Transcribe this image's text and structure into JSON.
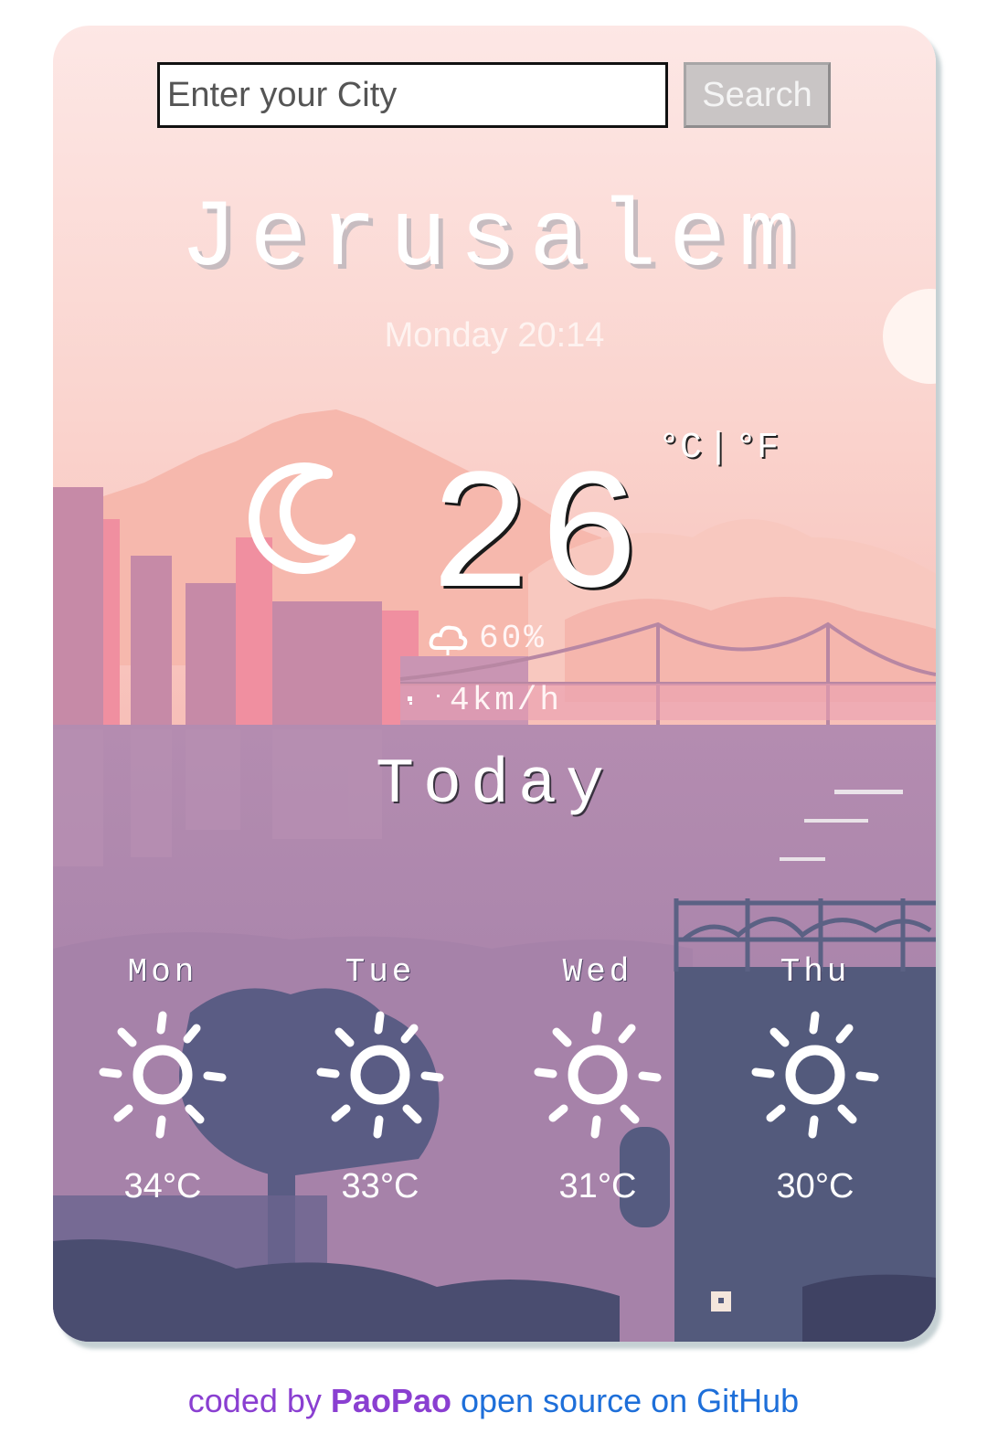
{
  "search": {
    "placeholder": "Enter your City",
    "value": "",
    "button_label": "Search"
  },
  "current": {
    "city": "Jerusalem",
    "datetime": "Monday 20:14",
    "unit_c": "°C",
    "unit_separator": "|",
    "unit_f": "°F",
    "temperature": "26",
    "icon": "crescent-moon-icon",
    "humidity": "60%",
    "humidity_icon": "cloud-icon",
    "wind": "4km/h",
    "wind_icon": "wind-icon"
  },
  "today_label": "Today",
  "forecast": [
    {
      "day": "Mon",
      "icon": "sun-icon",
      "temp": "34°C"
    },
    {
      "day": "Tue",
      "icon": "sun-icon",
      "temp": "33°C"
    },
    {
      "day": "Wed",
      "icon": "sun-icon",
      "temp": "31°C"
    },
    {
      "day": "Thu",
      "icon": "sun-icon",
      "temp": "30°C"
    }
  ],
  "footer": {
    "prefix": "coded by",
    "author": "PaoPao",
    "link_text": "open source on GitHub"
  },
  "colors": {
    "sky_top": "#fde6e4",
    "sky_mid": "#f8c6bf",
    "water": "#a882a8",
    "dark_silhouette": "#535a7c",
    "footer_purple": "#8a3fd1",
    "footer_blue": "#1e6fd9"
  }
}
